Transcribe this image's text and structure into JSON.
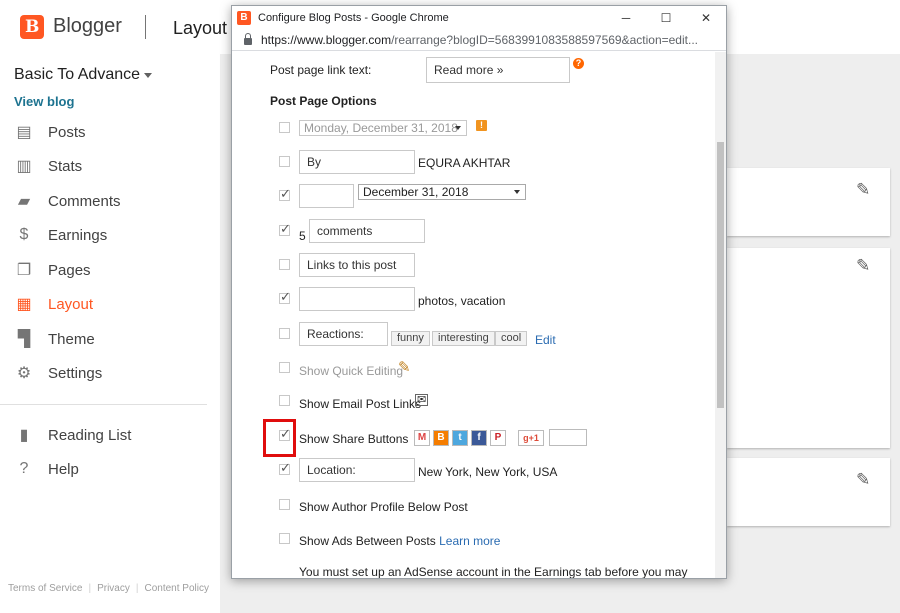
{
  "app": {
    "brand": "Blogger",
    "page_name": "Layout",
    "blog_title": "Basic To Advance",
    "view_blog": "View blog"
  },
  "sidebar": {
    "items": [
      {
        "label": "Posts",
        "icon": "posts-icon",
        "active": false
      },
      {
        "label": "Stats",
        "icon": "stats-icon",
        "active": false
      },
      {
        "label": "Comments",
        "icon": "comments-icon",
        "active": false
      },
      {
        "label": "Earnings",
        "icon": "dollar-icon",
        "active": false
      },
      {
        "label": "Pages",
        "icon": "pages-icon",
        "active": false
      },
      {
        "label": "Layout",
        "icon": "layout-icon",
        "active": true
      },
      {
        "label": "Theme",
        "icon": "theme-icon",
        "active": false
      },
      {
        "label": "Settings",
        "icon": "gear-icon",
        "active": false
      }
    ],
    "secondary": [
      {
        "label": "Reading List",
        "icon": "bookmark-icon"
      },
      {
        "label": "Help",
        "icon": "help-icon"
      }
    ],
    "footer": [
      "Terms of Service",
      "Privacy",
      "Content Policy"
    ]
  },
  "window": {
    "title": "Configure Blog Posts - Google Chrome",
    "url_host": "https://www.blogger.com",
    "url_path": "/rearrange?blogID=5683991083588597569&action=edit..."
  },
  "form": {
    "link_text_label": "Post page link text:",
    "link_text_value": "Read more »",
    "section_title": "Post Page Options",
    "date_value": "Monday, December 31, 2018",
    "by_value": "By",
    "author_name": "EQURA AKHTAR",
    "date2_value": "December 31, 2018",
    "comments_count": "5",
    "comments_value": "comments",
    "links_value": "Links to this post",
    "labels_value": "photos, vacation",
    "reactions_value": "Reactions:",
    "reaction_tags": [
      "funny",
      "interesting",
      "cool"
    ],
    "edit_link": "Edit",
    "quick_edit": "Show Quick Editing",
    "email_links": "Show Email Post Links",
    "share_buttons": "Show Share Buttons",
    "location_value": "Location:",
    "location_text": "New York, New York, USA",
    "author_profile": "Show Author Profile Below Post",
    "ads_between": "Show Ads Between Posts",
    "learn_more": "Learn more",
    "adsense_note": "You must set up an AdSense account in the Earnings tab before you may"
  },
  "colors": {
    "accent": "#ff5722",
    "link": "#2a6bb1",
    "highlight": "#e00d0d"
  }
}
